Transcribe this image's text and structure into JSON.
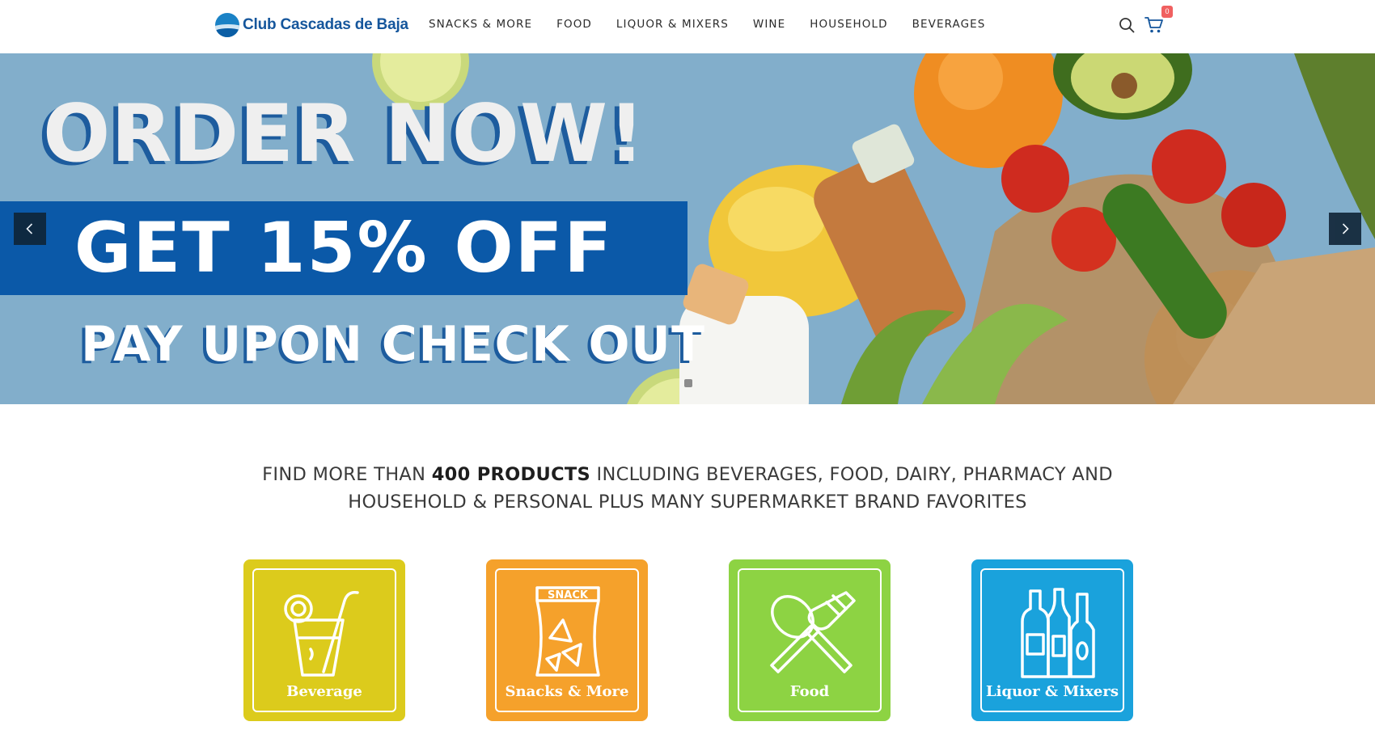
{
  "header": {
    "brand": "Club Cascadas de Baja",
    "nav": [
      "SNACKS & MORE",
      "FOOD",
      "LIQUOR & MIXERS",
      "WINE",
      "HOUSEHOLD",
      "BEVERAGES"
    ],
    "cart_count": "0",
    "icons": {
      "search": "search-icon",
      "cart": "cart-icon"
    }
  },
  "hero": {
    "title": "ORDER NOW!",
    "offer": "GET 15% OFF",
    "subtitle": "PAY UPON CHECK OUT",
    "colors": {
      "sky": "#82aecb",
      "band": "#0b59a8"
    }
  },
  "intro": {
    "part1": "FIND MORE THAN ",
    "bold": "400 PRODUCTS",
    "part2": " INCLUDING BEVERAGES, FOOD, DAIRY, PHARMACY AND HOUSEHOLD & PERSONAL PLUS MANY SUPERMARKET BRAND FAVORITES"
  },
  "categories": [
    {
      "label": "Beverage",
      "color": "#dccb1c",
      "icon": "drink-glass-icon"
    },
    {
      "label": "Snacks & More",
      "color": "#f5a12b",
      "icon": "snack-bag-icon"
    },
    {
      "label": "Food",
      "color": "#8dd343",
      "icon": "spoon-fork-icon"
    },
    {
      "label": "Liquor & Mixers",
      "color": "#1aa2dc",
      "icon": "bottles-icon"
    }
  ]
}
